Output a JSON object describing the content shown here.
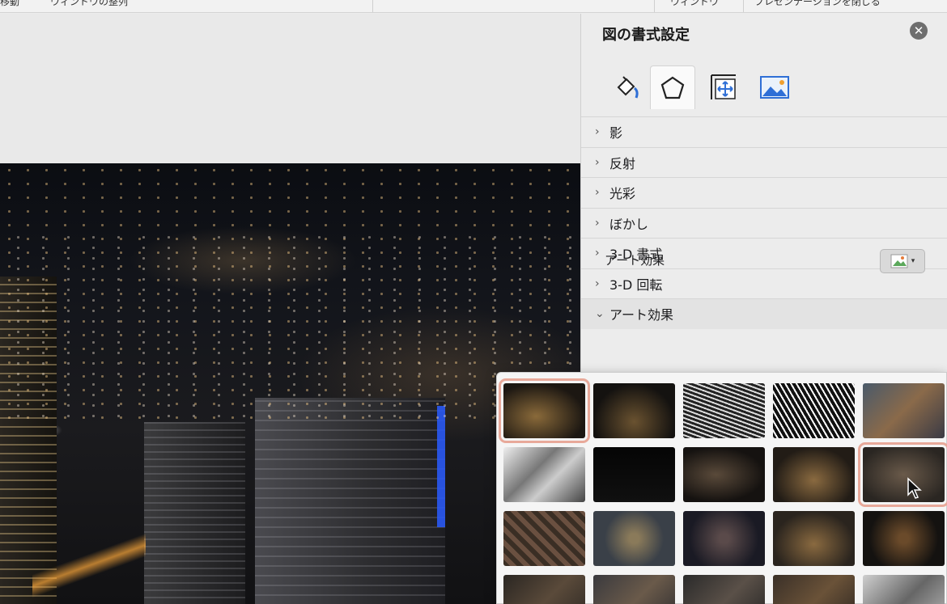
{
  "topbar": {
    "items": [
      "移動",
      "ウィンドウの整列",
      "ウィンドウ",
      "プレゼンテーションを閉じる"
    ]
  },
  "pane": {
    "title": "図の書式設定",
    "close_icon": "close-icon",
    "tabs": [
      {
        "icon": "fill-line-icon",
        "active": false
      },
      {
        "icon": "effects-pentagon-icon",
        "active": true
      },
      {
        "icon": "size-properties-icon",
        "active": false
      },
      {
        "icon": "picture-icon",
        "active": false
      }
    ],
    "sections": [
      {
        "label": "影",
        "expanded": false
      },
      {
        "label": "反射",
        "expanded": false
      },
      {
        "label": "光彩",
        "expanded": false
      },
      {
        "label": "ぼかし",
        "expanded": false
      },
      {
        "label": "3-D 書式",
        "expanded": false
      },
      {
        "label": "3-D 回転",
        "expanded": false
      },
      {
        "label": "アート効果",
        "expanded": true
      }
    ],
    "art_effect": {
      "label": "アート効果",
      "button_icon": "art-effect-icon"
    }
  },
  "gallery": {
    "selected_index": 0,
    "hover_index": 9,
    "rows": 4,
    "columns": 5,
    "thumbs": [
      "none",
      "marker",
      "pencil-grayscale",
      "pencil-sketch",
      "line-drawing",
      "chalk-sketch",
      "paint-strokes",
      "paint-brush",
      "glow-diffused",
      "blur",
      "light-screen",
      "watercolor-sponge",
      "film-grain",
      "mosaic-bubbles",
      "glass",
      "cement",
      "texturizer",
      "crisscross-etching",
      "pastels-smooth",
      "plastic-wrap"
    ]
  },
  "colors": {
    "selection_outline": "#e8a99a",
    "pane_bg": "#ececec"
  }
}
